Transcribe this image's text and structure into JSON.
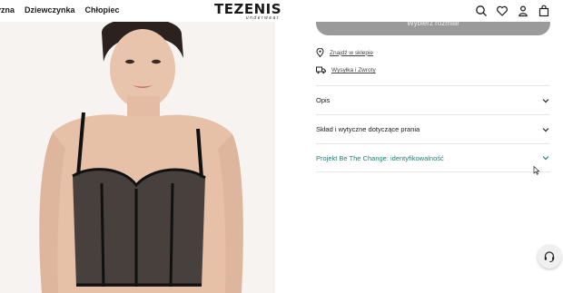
{
  "nav": {
    "items": [
      "yzna",
      "Dziewczynka",
      "Chłopiec"
    ]
  },
  "brand": {
    "name": "TEZENIS",
    "tagline": "underwear"
  },
  "header_icons": [
    "search-icon",
    "heart-icon",
    "user-icon",
    "bag-icon"
  ],
  "product": {
    "size_button": "Wybierz rozmiar",
    "store_link": "Znajdź w sklepie",
    "shipping_link": "Wysyłka i Zwroty"
  },
  "accordion": [
    {
      "label": "Opis"
    },
    {
      "label": "Skład i wytyczne dotyczące prania"
    },
    {
      "label": "Projekt Be The Change: identyfikowalność"
    }
  ],
  "colors": {
    "accent": "#2a7a72",
    "button": "#9a9a9a"
  }
}
